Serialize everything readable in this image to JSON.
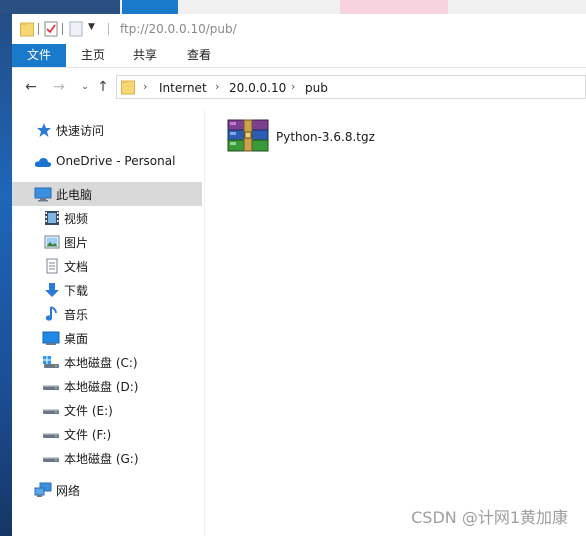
{
  "window": {
    "address_title": "ftp://20.0.0.10/pub/"
  },
  "ribbon": {
    "tabs": [
      {
        "label": "文件",
        "active": true
      },
      {
        "label": "主页",
        "active": false
      },
      {
        "label": "共享",
        "active": false
      },
      {
        "label": "查看",
        "active": false
      }
    ]
  },
  "address_bar": {
    "crumbs": [
      "Internet",
      "20.0.0.10",
      "pub"
    ]
  },
  "sidebar": {
    "items": [
      {
        "label": "快速访问",
        "icon": "star-icon"
      },
      {
        "label": "OneDrive - Personal",
        "icon": "cloud-icon"
      },
      {
        "label": "此电脑",
        "icon": "computer-icon",
        "selected": true
      },
      {
        "label": "视频",
        "icon": "video-icon"
      },
      {
        "label": "图片",
        "icon": "picture-icon"
      },
      {
        "label": "文档",
        "icon": "document-icon"
      },
      {
        "label": "下载",
        "icon": "download-icon"
      },
      {
        "label": "音乐",
        "icon": "music-icon"
      },
      {
        "label": "桌面",
        "icon": "desktop-icon"
      },
      {
        "label": "本地磁盘 (C:)",
        "icon": "system-drive-icon"
      },
      {
        "label": "本地磁盘 (D:)",
        "icon": "drive-icon"
      },
      {
        "label": "文件 (E:)",
        "icon": "drive-icon"
      },
      {
        "label": "文件 (F:)",
        "icon": "drive-icon"
      },
      {
        "label": "本地磁盘 (G:)",
        "icon": "drive-icon"
      },
      {
        "label": "网络",
        "icon": "network-icon"
      }
    ]
  },
  "content": {
    "files": [
      {
        "name": "Python-3.6.8.tgz",
        "icon": "archive-icon"
      }
    ]
  },
  "watermark": "CSDN @计网1黄加康",
  "colors": {
    "accent": "#1979ca",
    "selected": "#d9d9d9"
  }
}
